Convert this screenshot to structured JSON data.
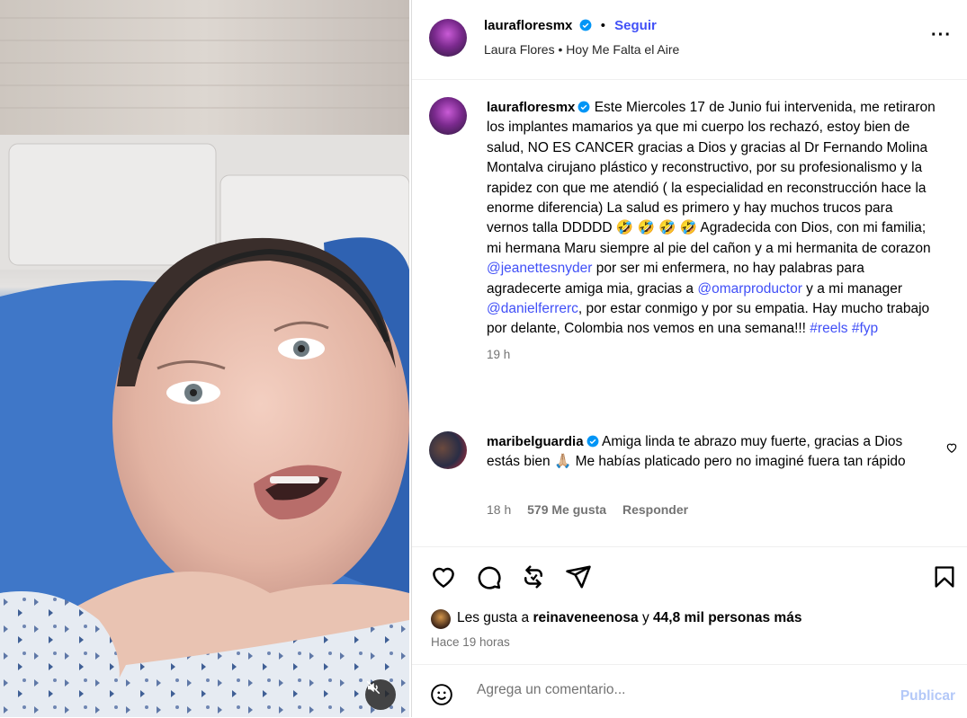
{
  "video": {
    "mute_icon": "speaker-muted-icon"
  },
  "header": {
    "username": "laurafloresmx",
    "dot": "•",
    "follow_label": "Seguir",
    "subtitle": "Laura Flores • Hoy Me Falta el Aire",
    "more_icon": "more-options-icon",
    "more_label": "···"
  },
  "caption": {
    "username": "laurafloresmx",
    "text_1": "Este Miercoles 17 de Junio fui intervenida, me retiraron los implantes mamarios ya que mi cuerpo los rechazó, estoy bien de salud, NO ES CANCER gracias a Dios y gracias al Dr Fernando Molina Montalva cirujano plástico y reconstructivo, por su profesionalismo y la rapidez con que me atendió ( la especialidad en reconstrucción hace la enorme diferencia) La salud es primero y hay muchos trucos para vernos talla DDDDD",
    "emojis": "🤣 🤣 🤣 🤣",
    "text_2": " Agradecida con Dios, con mi familia; mi hermana Maru siempre al pie del cañon y a mi hermanita de corazon ",
    "mention_1": "@jeanettesnyder",
    "text_3": " por ser mi enfermera, no hay palabras para agradecerte amiga mia, gracias a ",
    "mention_2": "@omarproductor",
    "text_4": " y a mi manager ",
    "mention_3": "@danielferrerc",
    "text_5": ", por estar conmigo y por su empatia. Hay mucho trabajo por delante, Colombia nos vemos en una semana!!! ",
    "hashtag_1": "#reels",
    "hashtag_2": "#fyp",
    "time": "19 h"
  },
  "comment": {
    "username": "maribelguardia",
    "text_1": "Amiga linda te abrazo muy fuerte, gracias a Dios estás bien ",
    "emoji": "🙏🏼",
    "text_2": " Me habías platicado pero no imaginé fuera tan rápido",
    "time": "18 h",
    "likes": "579 Me gusta",
    "reply": "Responder"
  },
  "actions": {
    "icons": [
      "heart-icon",
      "comment-icon",
      "share-icon",
      "send-icon",
      "bookmark-icon"
    ]
  },
  "likes": {
    "prefix": "Les gusta a ",
    "user": "reinaveneenosa",
    "mid": " y ",
    "count": "44,8 mil personas más"
  },
  "ago": "Hace 19 horas",
  "add_comment": {
    "placeholder": "Agrega un comentario...",
    "publish": "Publicar",
    "emoji_icon": "emoji-icon"
  },
  "colors": {
    "link": "#4150f7",
    "verified": "#0095f6",
    "muted": "#737373"
  }
}
